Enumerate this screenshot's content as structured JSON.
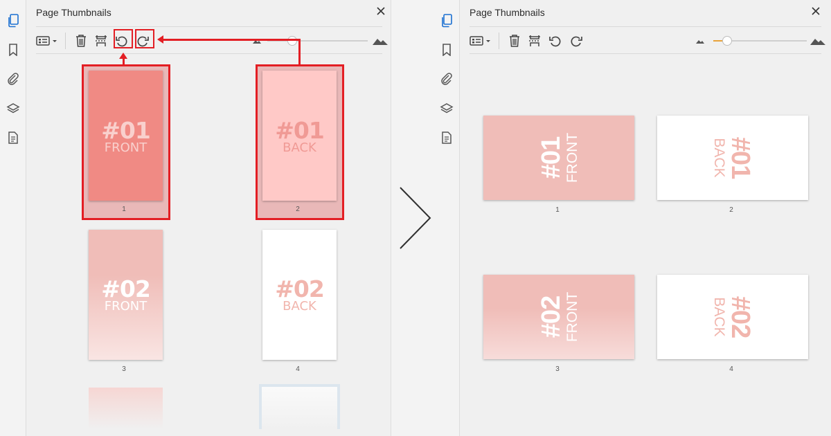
{
  "before": {
    "panel_title": "Page Thumbnails",
    "slider_level": 0.25,
    "pages": [
      {
        "number": "1",
        "title": "#01",
        "subtitle": "FRONT"
      },
      {
        "number": "2",
        "title": "#01",
        "subtitle": "BACK"
      },
      {
        "number": "3",
        "title": "#02",
        "subtitle": "FRONT"
      },
      {
        "number": "4",
        "title": "#02",
        "subtitle": "BACK"
      }
    ]
  },
  "after": {
    "panel_title": "Page Thumbnails",
    "slider_level": 0.15,
    "pages": [
      {
        "number": "1",
        "title": "#01",
        "subtitle": "FRONT"
      },
      {
        "number": "2",
        "title": "#01",
        "subtitle": "BACK"
      },
      {
        "number": "3",
        "title": "#02",
        "subtitle": "FRONT"
      },
      {
        "number": "4",
        "title": "#02",
        "subtitle": "BACK"
      }
    ]
  },
  "icons": {
    "sidebar": [
      "page-thumbnails-icon",
      "bookmark-icon",
      "attachment-icon",
      "layers-icon",
      "document-icon"
    ],
    "toolbar": [
      "options-menu-icon",
      "delete-pages-icon",
      "insert-pages-icon",
      "rotate-counterclockwise-icon",
      "rotate-clockwise-icon",
      "zoom-out-icon",
      "zoom-in-icon"
    ],
    "transition": "chevron-right-icon"
  },
  "colors": {
    "highlight": "#e31e24",
    "accent_blue": "#1a6fd1",
    "slider_fill": "#e8a33a",
    "front_card": "#f0bdb8",
    "back_card": "#ffffff",
    "rotated_text": "#f1b5ad"
  }
}
